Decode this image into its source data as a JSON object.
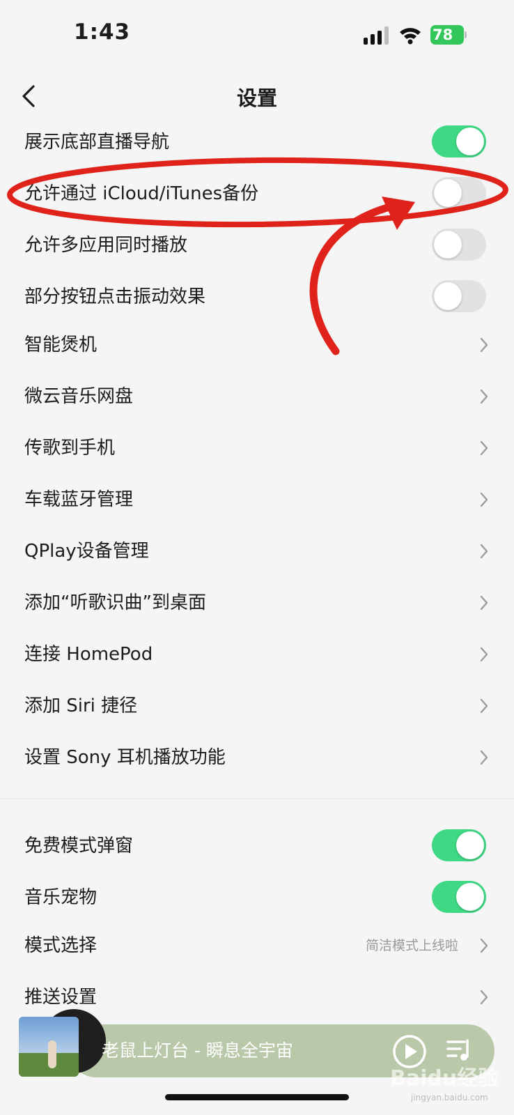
{
  "status_bar": {
    "time": "1:43",
    "battery": "78"
  },
  "nav": {
    "title": "设置"
  },
  "settings": [
    {
      "label": "展示底部直播导航",
      "type": "toggle",
      "on": true
    },
    {
      "label": "允许通过 iCloud/iTunes备份",
      "type": "toggle",
      "on": false
    },
    {
      "label": "允许多应用同时播放",
      "type": "toggle",
      "on": false
    },
    {
      "label": "部分按钮点击振动效果",
      "type": "toggle",
      "on": false
    },
    {
      "label": "智能煲机",
      "type": "link"
    },
    {
      "label": "微云音乐网盘",
      "type": "link"
    },
    {
      "label": "传歌到手机",
      "type": "link"
    },
    {
      "label": "车载蓝牙管理",
      "type": "link"
    },
    {
      "label": "QPlay设备管理",
      "type": "link"
    },
    {
      "label": "添加“听歌识曲”到桌面",
      "type": "link"
    },
    {
      "label": "连接 HomePod",
      "type": "link"
    },
    {
      "label": "添加 Siri 捷径",
      "type": "link"
    },
    {
      "label": "设置 Sony 耳机播放功能",
      "type": "link"
    }
  ],
  "settings2": [
    {
      "label": "免费模式弹窗",
      "type": "toggle",
      "on": true
    },
    {
      "label": "音乐宠物",
      "type": "toggle",
      "on": true
    },
    {
      "label": "模式选择",
      "type": "link",
      "value": "简洁模式上线啦"
    },
    {
      "label": "推送设置",
      "type": "link"
    }
  ],
  "player": {
    "song": "老鼠上灯台 - 瞬息全宇宙"
  },
  "watermark": {
    "text": "Baidu经验",
    "sub": "jingyan.baidu.com"
  },
  "colors": {
    "toggle_on": "#3fd884",
    "annotation": "#e0231a",
    "player_bg": "#b9c8a9"
  },
  "icons": [
    "back-chevron-icon",
    "chevron-right-icon",
    "play-icon",
    "playlist-icon",
    "signal-icon",
    "wifi-icon",
    "battery-icon"
  ]
}
